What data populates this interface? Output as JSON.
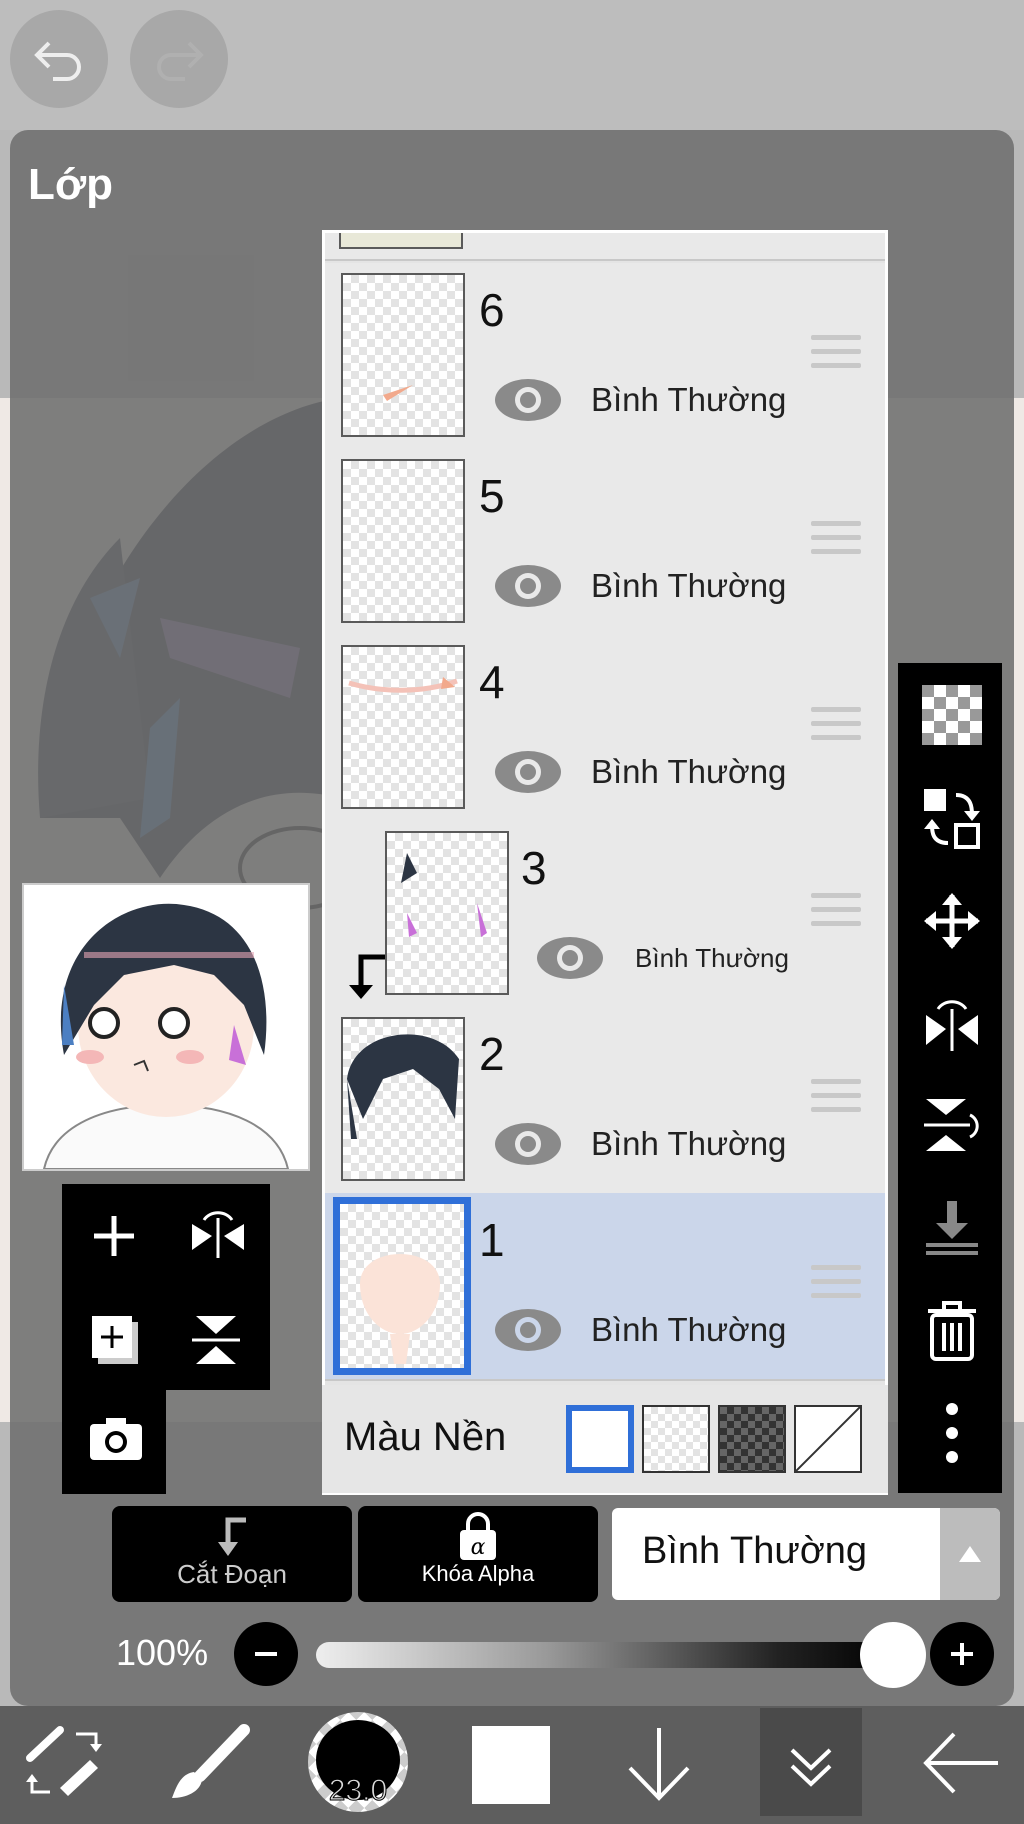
{
  "panel": {
    "title": "Lớp"
  },
  "layers": [
    {
      "number": "6",
      "blend": "Bình Thường"
    },
    {
      "number": "5",
      "blend": "Bình Thường"
    },
    {
      "number": "4",
      "blend": "Bình Thường"
    },
    {
      "number": "3",
      "blend": "Bình Thường"
    },
    {
      "number": "2",
      "blend": "Bình Thường"
    },
    {
      "number": "1",
      "blend": "Bình Thường"
    }
  ],
  "background": {
    "label": "Màu Nền"
  },
  "actions": {
    "clipping": "Cắt Đoạn",
    "alpha_lock": "Khóa Alpha",
    "blend_mode": "Bình Thường"
  },
  "opacity": {
    "label": "100%",
    "value": 100
  },
  "brush": {
    "size": "23.0"
  },
  "colors": {
    "selected_border": "#2f6fd8",
    "selected_row": "#cbd6ea",
    "current_color": "#ffffff"
  }
}
